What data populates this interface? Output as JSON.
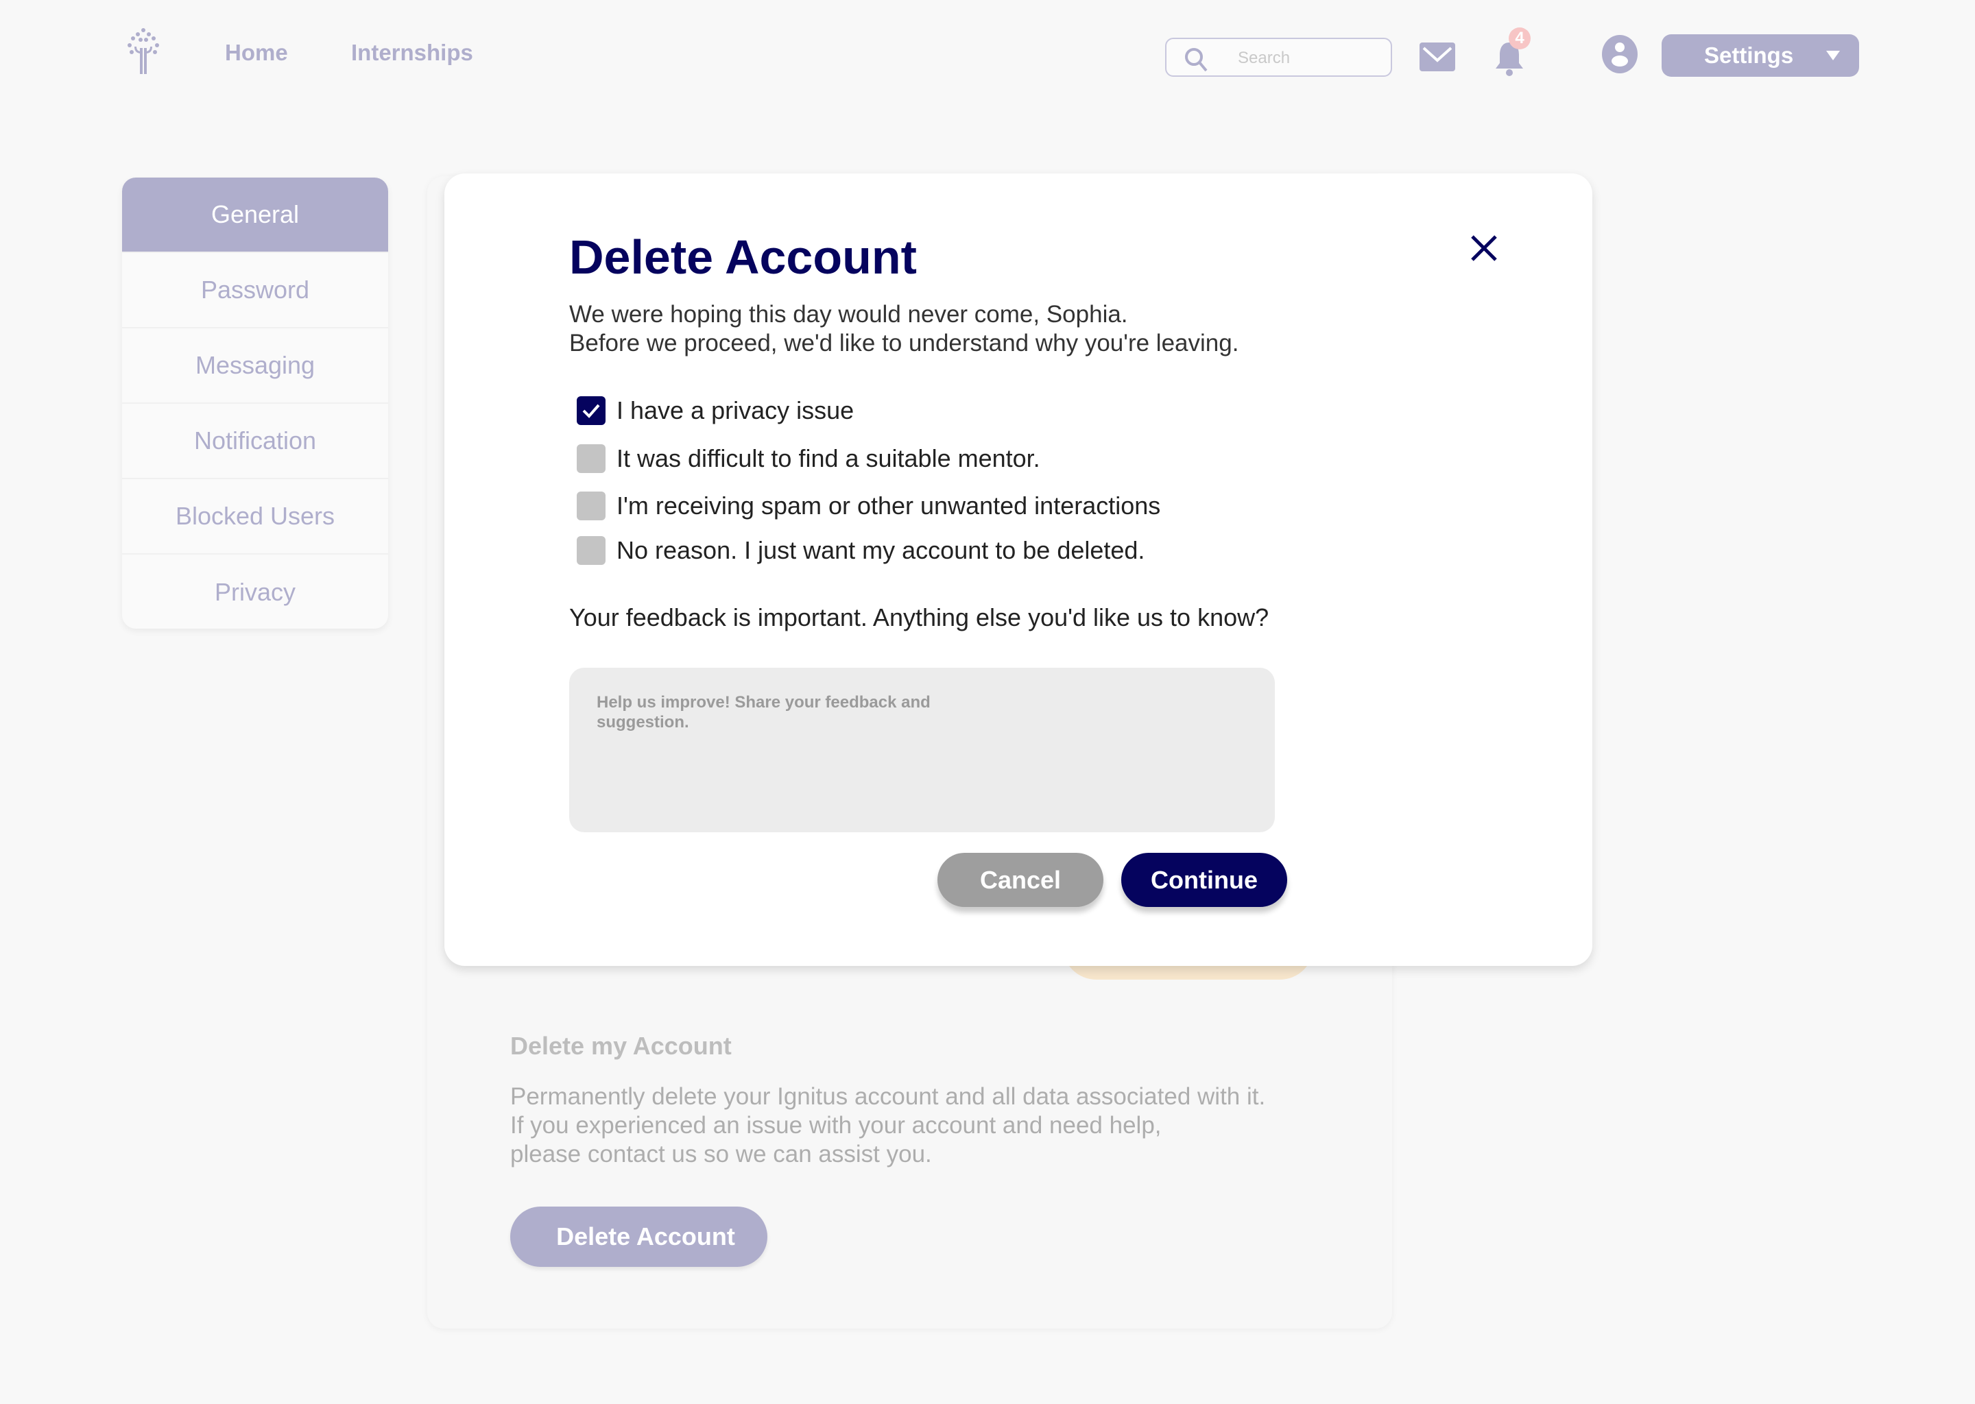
{
  "header": {
    "logo": "tree-flame-logo",
    "nav": [
      {
        "label": "Home"
      },
      {
        "label": "Internships"
      }
    ],
    "search": {
      "placeholder": "Search"
    },
    "notification_count": "4",
    "settings_label": "Settings"
  },
  "sidebar": {
    "items": [
      {
        "label": "General",
        "active": true
      },
      {
        "label": "Password"
      },
      {
        "label": "Messaging"
      },
      {
        "label": "Notification"
      },
      {
        "label": "Blocked Users"
      },
      {
        "label": "Privacy"
      }
    ]
  },
  "background": {
    "heading": "Delete my Account",
    "lines": [
      "Permanently delete your Ignitus account and all data associated with it.",
      "If you experienced an issue with your account and need help,",
      "please contact us so we can assist you."
    ],
    "button": "Delete Account"
  },
  "modal": {
    "title": "Delete Account",
    "subtitle_lines": [
      "We were hoping this day would never come, Sophia.",
      "Before we proceed, we'd like to understand why you're leaving."
    ],
    "reasons": [
      {
        "label": "I have a privacy issue",
        "checked": true
      },
      {
        "label": "It was difficult to find a suitable mentor.",
        "checked": false
      },
      {
        "label": "I'm receiving spam or other unwanted interactions",
        "checked": false
      },
      {
        "label": "No reason. I just want my account to be deleted.",
        "checked": false
      }
    ],
    "feedback_question": "Your feedback is important. Anything else you'd like us to know?",
    "feedback_placeholder": "Help us improve! Share your feedback and suggestion.",
    "cancel": "Cancel",
    "continue": "Continue"
  },
  "colors": {
    "accent": "#afaecc",
    "primary": "#05035e",
    "badge": "#f7c5c5",
    "cancel": "#9e9e9e"
  }
}
